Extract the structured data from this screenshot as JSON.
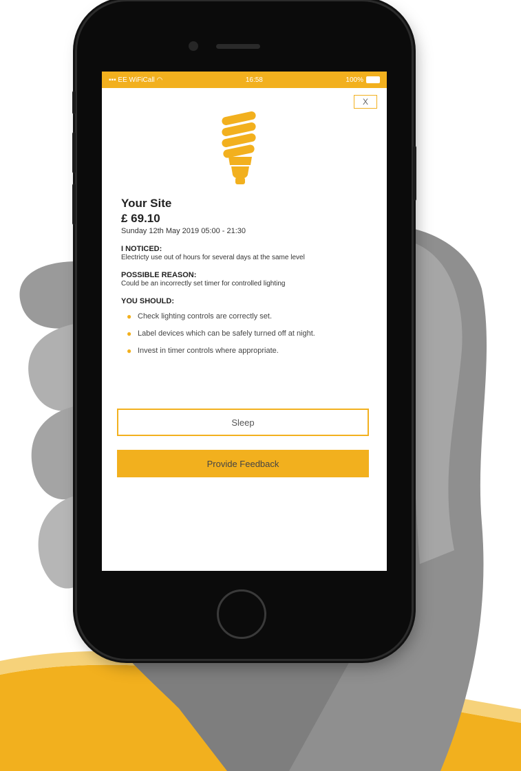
{
  "colors": {
    "accent": "#f2b01e",
    "phone_body": "#0b0b0b"
  },
  "statusbar": {
    "carrier": "EE WiFiCall",
    "wifi_icon": "wifi-icon",
    "time": "16:58",
    "battery_text": "100%",
    "battery_icon": "battery-icon"
  },
  "close_label": "X",
  "hero_icon": "lightbulb-icon",
  "alert": {
    "site": "Your Site",
    "amount": "£ 69.10",
    "date": "Sunday 12th May 2019 05:00 - 21:30",
    "noticed_heading": "I NOTICED:",
    "noticed_text": "Electricty use out of hours for several days at the same level",
    "reason_heading": "POSSIBLE REASON:",
    "reason_text": "Could be an incorrectly set timer for controlled lighting",
    "should_heading": "YOU SHOULD:",
    "tips": [
      "Check lighting controls are correctly set.",
      "Label devices which can be safely turned off at night.",
      "Invest in timer controls where appropriate."
    ]
  },
  "buttons": {
    "sleep": "Sleep",
    "feedback": "Provide Feedback"
  }
}
